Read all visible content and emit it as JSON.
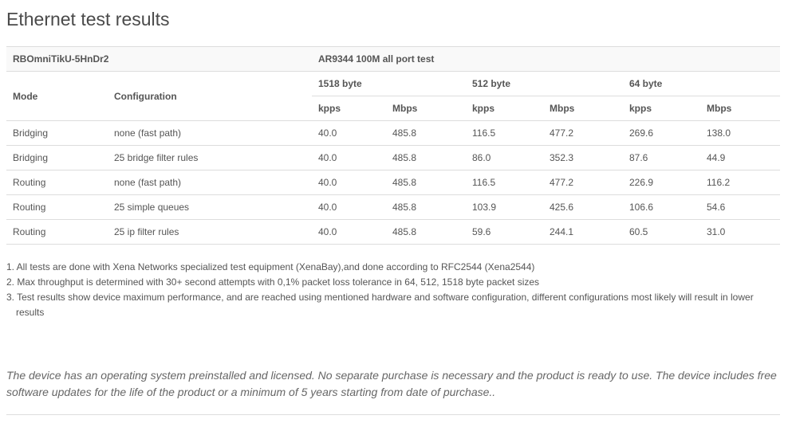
{
  "page": {
    "title": "Ethernet test results"
  },
  "table": {
    "device": "RBOmniTikU-5HnDr2",
    "test_name": "AR9344 100M all port test",
    "mode_header": "Mode",
    "configuration_header": "Configuration",
    "packet_sizes": [
      "1518 byte",
      "512 byte",
      "64 byte"
    ],
    "unit_kpps": "kpps",
    "unit_mbps": "Mbps",
    "rows": [
      {
        "mode": "Bridging",
        "configuration": "none (fast path)",
        "kpps_1518": "40.0",
        "mbps_1518": "485.8",
        "kpps_512": "116.5",
        "mbps_512": "477.2",
        "kpps_64": "269.6",
        "mbps_64": "138.0"
      },
      {
        "mode": "Bridging",
        "configuration": "25 bridge filter rules",
        "kpps_1518": "40.0",
        "mbps_1518": "485.8",
        "kpps_512": "86.0",
        "mbps_512": "352.3",
        "kpps_64": "87.6",
        "mbps_64": "44.9"
      },
      {
        "mode": "Routing",
        "configuration": "none (fast path)",
        "kpps_1518": "40.0",
        "mbps_1518": "485.8",
        "kpps_512": "116.5",
        "mbps_512": "477.2",
        "kpps_64": "226.9",
        "mbps_64": "116.2"
      },
      {
        "mode": "Routing",
        "configuration": "25 simple queues",
        "kpps_1518": "40.0",
        "mbps_1518": "485.8",
        "kpps_512": "103.9",
        "mbps_512": "425.6",
        "kpps_64": "106.6",
        "mbps_64": "54.6"
      },
      {
        "mode": "Routing",
        "configuration": "25 ip filter rules",
        "kpps_1518": "40.0",
        "mbps_1518": "485.8",
        "kpps_512": "59.6",
        "mbps_512": "244.1",
        "kpps_64": "60.5",
        "mbps_64": "31.0"
      }
    ]
  },
  "footnotes": [
    "1. All tests are done with Xena Networks specialized test equipment (XenaBay),and done according to RFC2544 (Xena2544)",
    "2. Max throughput is determined with 30+ second attempts with 0,1% packet loss tolerance in 64, 512, 1518 byte packet sizes",
    "3. Test results show device maximum performance, and are reached using mentioned hardware and software configuration, different configurations most likely will result in lower results"
  ],
  "description": "The device has an operating system preinstalled and licensed. No separate purchase is necessary and the product is ready to use. The device includes free software updates for the life of the product or a minimum of 5 years starting from date of purchase.."
}
